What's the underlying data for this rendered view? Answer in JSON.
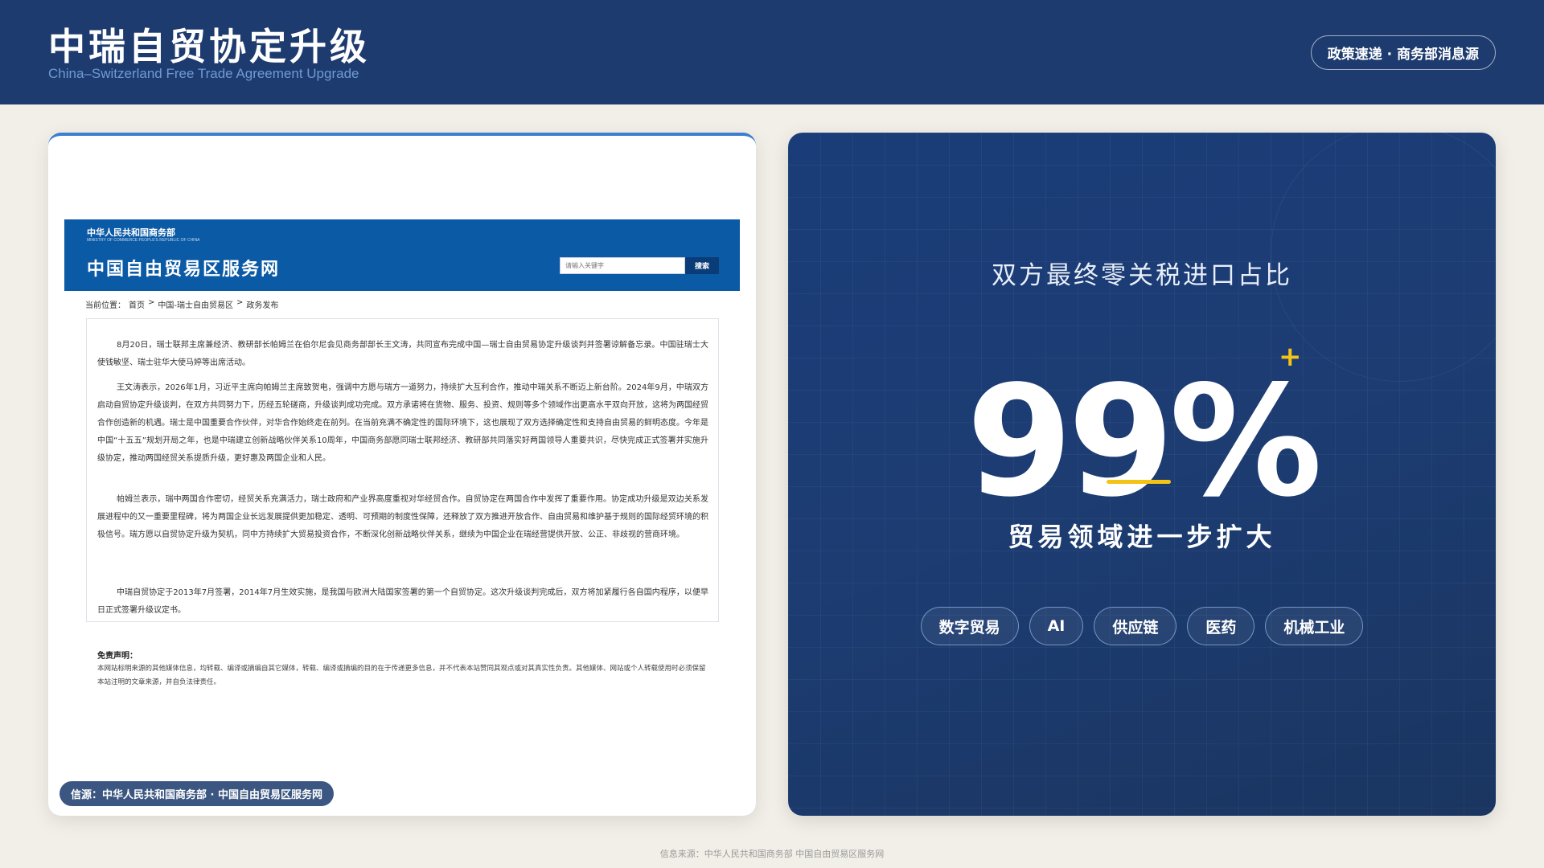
{
  "header": {
    "title": "中瑞自贸协定升级",
    "subtitle": "China–Switzerland Free Trade Agreement Upgrade",
    "badge": "政策速递 · 商务部消息源"
  },
  "screenshot": {
    "ministry_name": "中华人民共和国商务部",
    "ministry_en": "MINISTRY OF COMMERCE PEOPLE'S REPUBLIC OF CHINA",
    "site_title": "中国自由贸易区服务网",
    "search_placeholder": "请输入关键字",
    "search_button": "搜索",
    "breadcrumb": {
      "label": "当前位置：",
      "items": [
        "首页",
        ">",
        "中国-瑞士自由贸易区",
        ">",
        "政务发布"
      ]
    },
    "paragraphs": [
      "8月20日，瑞士联邦主席兼经济、教研部长帕姆兰在伯尔尼会见商务部部长王文涛，共同宣布完成中国—瑞士自由贸易协定升级谈判并签署谅解备忘录。中国驻瑞士大使钱敏坚、瑞士驻华大使马婷等出席活动。",
      "王文涛表示，2026年1月，习近平主席向帕姆兰主席致贺电，强调中方愿与瑞方一道努力，持续扩大互利合作，推动中瑞关系不断迈上新台阶。2024年9月，中瑞双方启动自贸协定升级谈判，在双方共同努力下，历经五轮磋商，升级谈判成功完成。双方承诺将在货物、服务、投资、规则等多个领域作出更高水平双向开放，这将为两国经贸合作创造新的机遇。瑞士是中国重要合作伙伴，对华合作始终走在前列。在当前充满不确定性的国际环境下，这也展现了双方选择确定性和支持自由贸易的鲜明态度。今年是中国“十五五”规划开局之年，也是中瑞建立创新战略伙伴关系10周年，中国商务部愿同瑞士联邦经济、教研部共同落实好两国领导人重要共识，尽快完成正式签署并实施升级协定，推动两国经贸关系提质升级，更好惠及两国企业和人民。",
      "帕姆兰表示，瑞中两国合作密切，经贸关系充满活力，瑞士政府和产业界高度重视对华经贸合作。自贸协定在两国合作中发挥了重要作用。协定成功升级是双边关系发展进程中的又一重要里程碑，将为两国企业长远发展提供更加稳定、透明、可预期的制度性保障，还释放了双方推进开放合作、自由贸易和维护基于规则的国际经贸环境的积极信号。瑞方愿以自贸协定升级为契机，同中方持续扩大贸易投资合作，不断深化创新战略伙伴关系，继续为中国企业在瑞经营提供开放、公正、非歧视的营商环境。",
      "中瑞自贸协定于2013年7月签署，2014年7月生效实施，是我国与欧洲大陆国家签署的第一个自贸协定。这次升级谈判完成后，双方将加紧履行各自国内程序，以便早日正式签署升级议定书。"
    ],
    "disclaimer_title": "免责声明：",
    "disclaimer_text": "本网站标明来源的其他媒体信息，均转载、编译或摘编自其它媒体，转载、编译或摘编的目的在于传递更多信息，并不代表本站赞同其观点或对其真实性负责。其他媒体、网站或个人转载使用时必须保留本站注明的文章来源，并自负法律责任。",
    "source_pill": "信源：中华人民共和国商务部 · 中国自由贸易区服务网"
  },
  "metric": {
    "label": "双方最终零关税进口占比",
    "value": "99%",
    "plus_icon": "+",
    "caption": "贸易领域进一步扩大",
    "accent_color": "#f3c316",
    "tags": [
      "数字贸易",
      "AI",
      "供应链",
      "医药",
      "机械工业"
    ]
  },
  "footer": {
    "text": "信息来源：中华人民共和国商务部 中国自由贸易区服务网"
  }
}
